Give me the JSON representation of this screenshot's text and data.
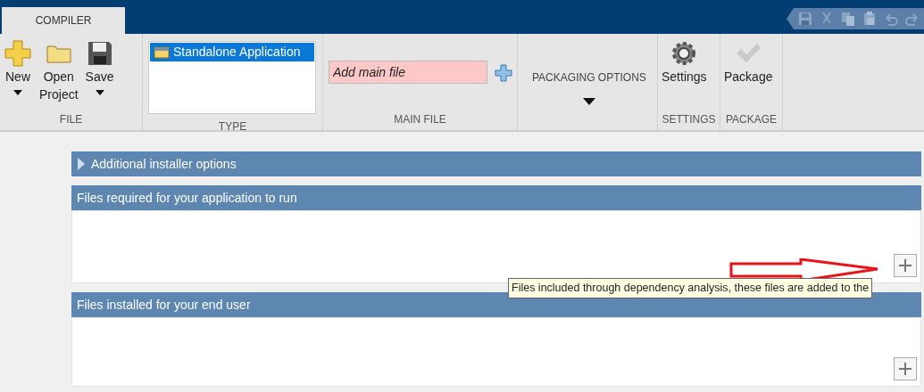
{
  "tabs": [
    {
      "label": "COMPILER",
      "selected": true
    }
  ],
  "quick_access": [
    {
      "kind": "save"
    },
    {
      "kind": "cut"
    },
    {
      "kind": "copy"
    },
    {
      "kind": "paste"
    },
    {
      "kind": "undo"
    },
    {
      "kind": "redo"
    }
  ],
  "ribbon": {
    "file": {
      "label": "FILE",
      "buttons": [
        {
          "kind": "new",
          "lines": [
            "New"
          ],
          "dropdown": true
        },
        {
          "kind": "open",
          "lines": [
            "Open",
            "Project"
          ],
          "dropdown": false
        },
        {
          "kind": "save",
          "lines": [
            "Save"
          ],
          "dropdown": true
        }
      ]
    },
    "type": {
      "label": "TYPE",
      "items": [
        {
          "text": "Standalone Application",
          "selected": true
        }
      ]
    },
    "main_file": {
      "label": "MAIN FILE",
      "placeholder": "Add main file"
    },
    "packaging_options": {
      "label": "PACKAGING OPTIONS"
    },
    "settings": {
      "label": "SETTINGS",
      "button": "Settings"
    },
    "package": {
      "label": "PACKAGE",
      "button": "Package",
      "disabled": true
    }
  },
  "sections": [
    {
      "kind": "collapsible",
      "title": "Additional installer options",
      "expanded": false
    },
    {
      "kind": "panel",
      "title": "Files required for your application to run"
    },
    {
      "kind": "panel",
      "title": "Files installed for your end user"
    }
  ],
  "tooltip": "Files included through dependency analysis, these files are added to the"
}
